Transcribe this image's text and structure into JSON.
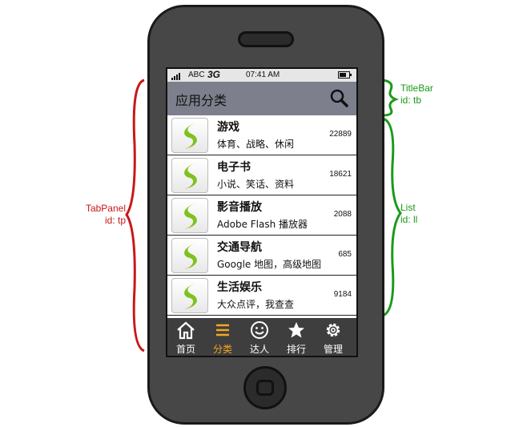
{
  "status_bar": {
    "carrier": "ABC",
    "network": "3G",
    "time": "07:41 AM"
  },
  "title_bar": {
    "title": "应用分类",
    "search_icon": "magnifier-icon"
  },
  "list": {
    "items": [
      {
        "name": "游戏",
        "desc": "体育、战略、休闲",
        "count": "22889"
      },
      {
        "name": "电子书",
        "desc": "小说、笑话、资料",
        "count": "18621"
      },
      {
        "name": "影音播放",
        "desc": "Adobe Flash 播放器",
        "count": "2088"
      },
      {
        "name": "交通导航",
        "desc": "Google 地图，高级地图",
        "count": "685"
      },
      {
        "name": "生活娱乐",
        "desc": "大众点评，我查查",
        "count": "9184"
      }
    ]
  },
  "tabs": [
    {
      "label": "首页",
      "icon": "home-icon"
    },
    {
      "label": "分类",
      "icon": "list-icon",
      "active": true
    },
    {
      "label": "达人",
      "icon": "smiley-icon"
    },
    {
      "label": "排行",
      "icon": "star-icon"
    },
    {
      "label": "管理",
      "icon": "gear-icon"
    }
  ],
  "annotations": {
    "titlebar": {
      "name": "TitleBar",
      "id": "id: tb"
    },
    "list": {
      "name": "List",
      "id": "id: ll"
    },
    "tabpanel": {
      "name": "TabPanel",
      "id": "id: tp"
    }
  },
  "colors": {
    "title_bar": "#7d7f8c",
    "tab_active": "#f5a623",
    "annotation_green": "#1a9a1a",
    "annotation_red": "#c81818"
  }
}
